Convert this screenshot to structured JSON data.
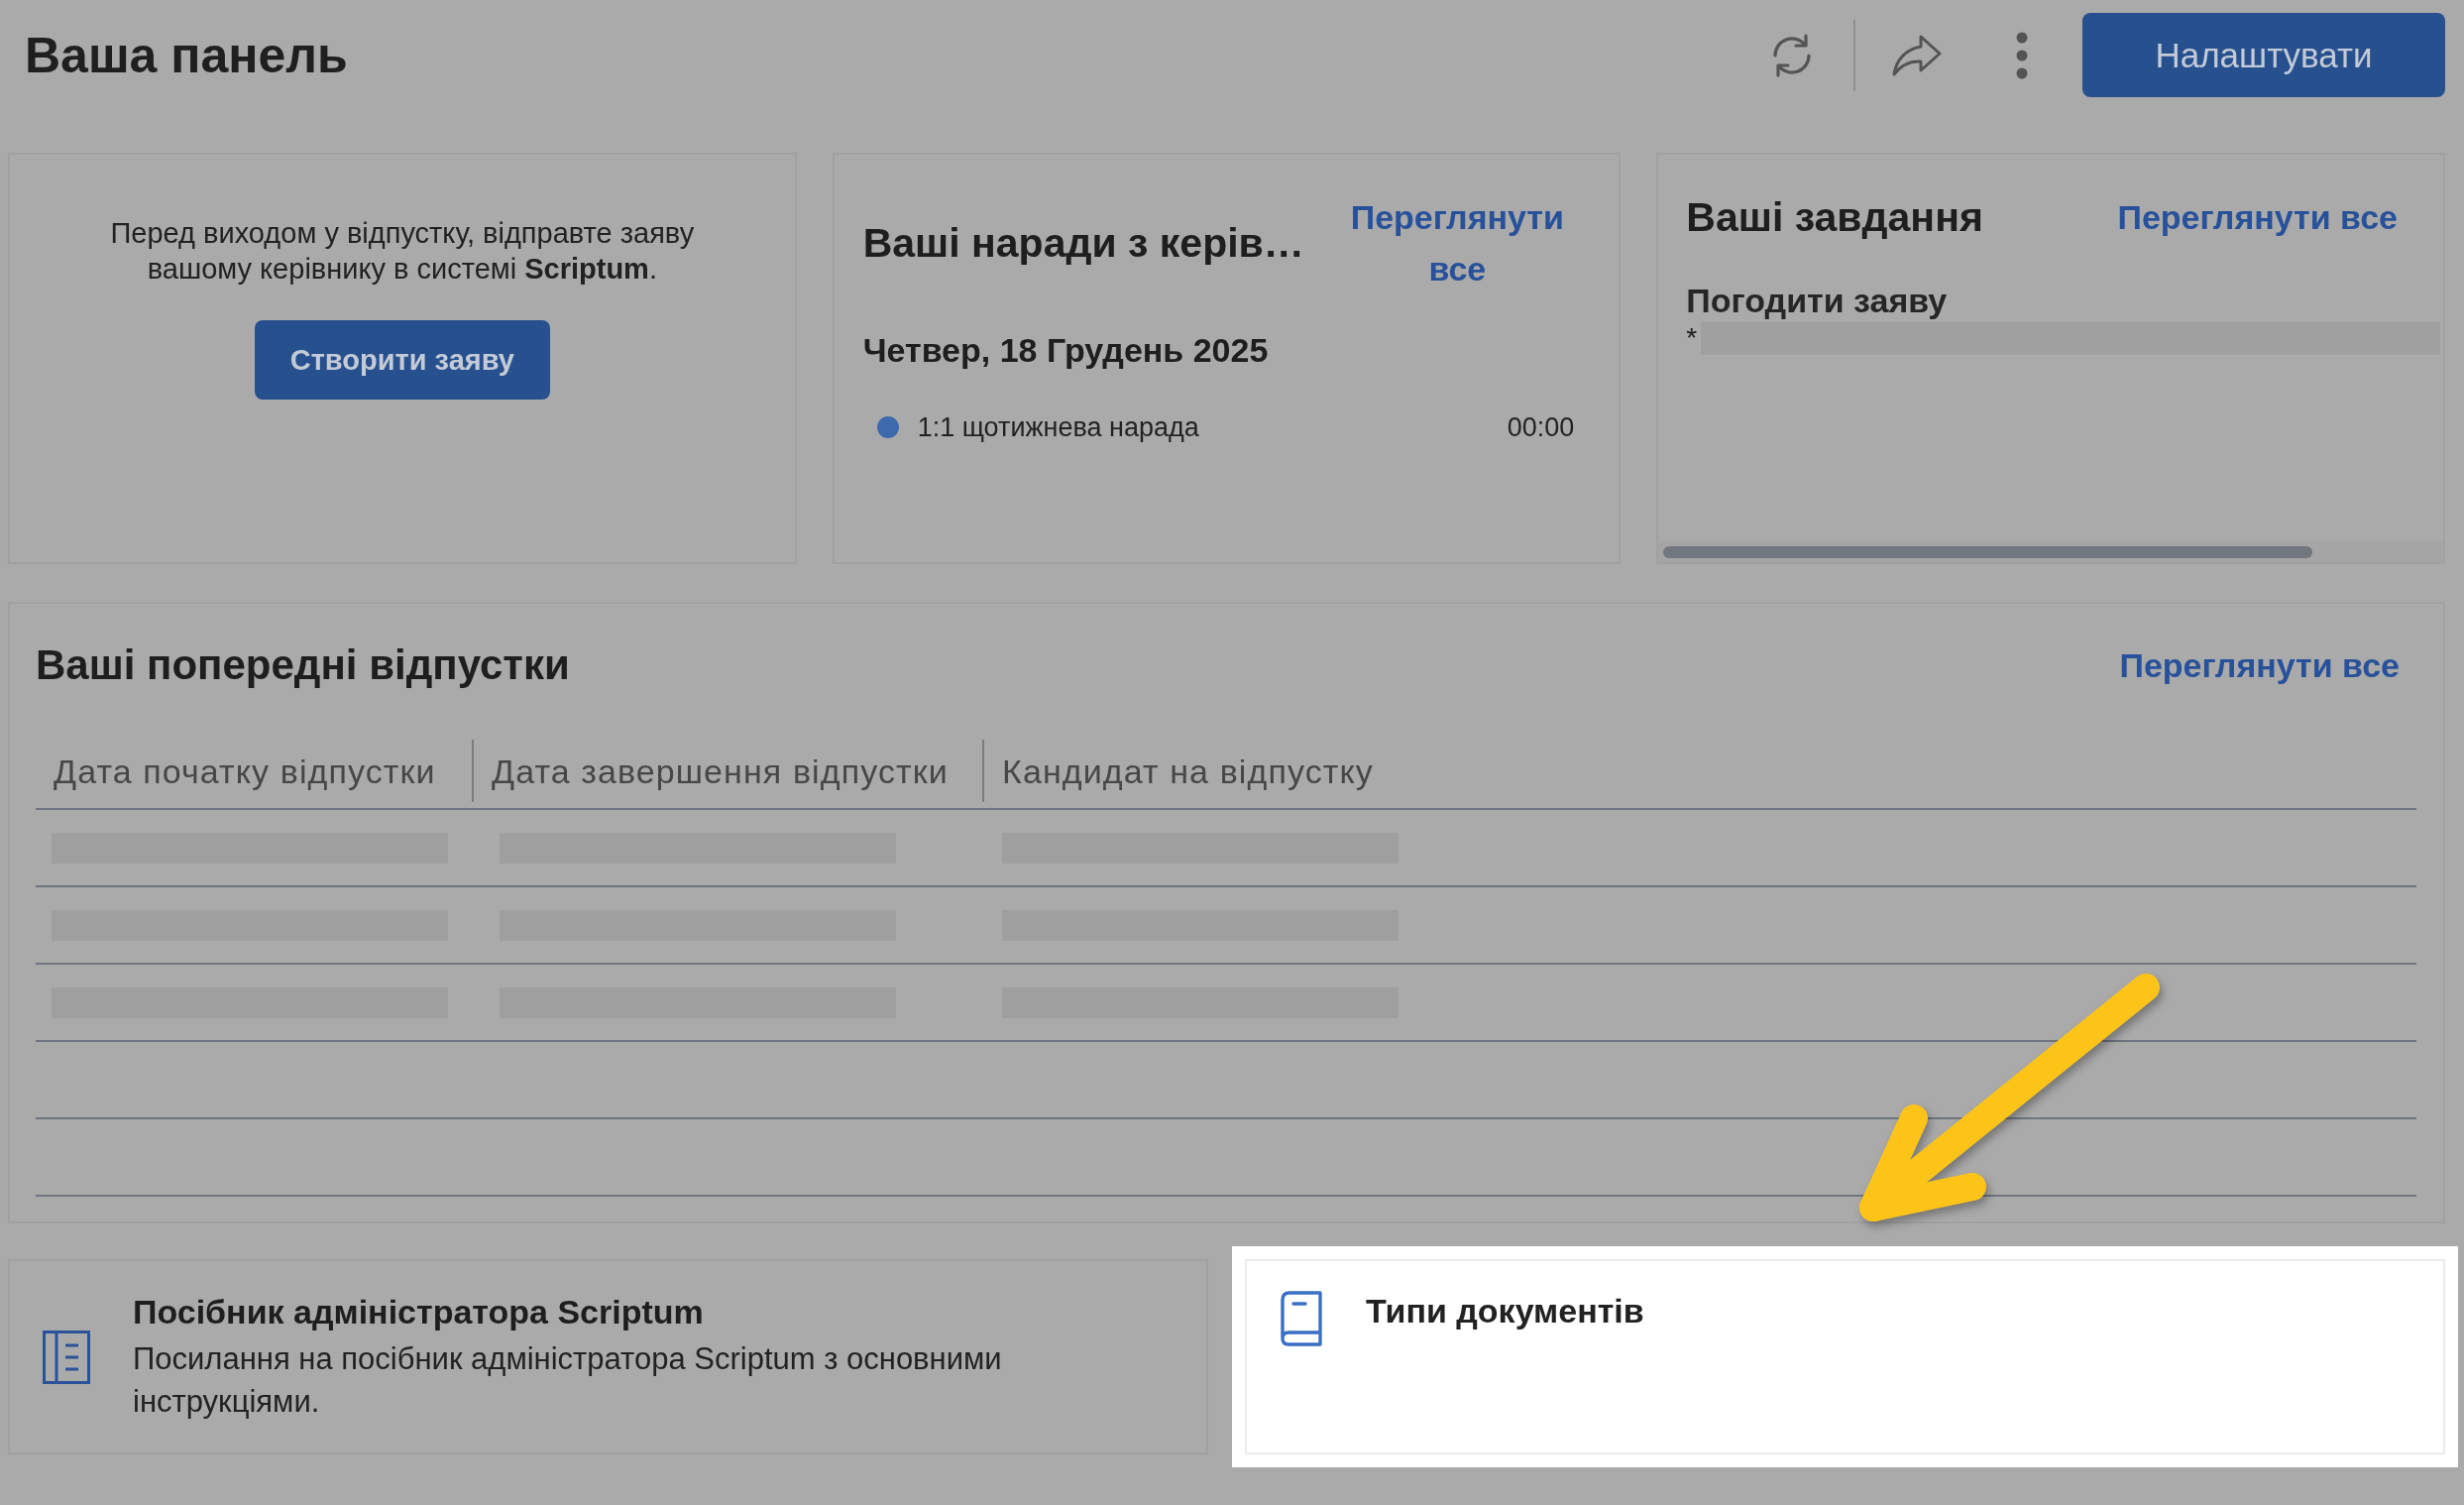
{
  "header": {
    "title": "Ваша панель",
    "settings_button": "Налаштувати"
  },
  "leave_request": {
    "message": "Перед виходом у відпустку, відправте заяву вашому керівнику в системі **Scriptum**.",
    "button": "Створити заяву"
  },
  "meetings": {
    "title": "Ваші наради з керів…",
    "view_all": "Переглянути все",
    "date": "Четвер, 18 Грудень 2025",
    "items": [
      {
        "title": "1:1 щотижнева нарада",
        "time": "00:00"
      }
    ]
  },
  "tasks": {
    "title": "Ваші завдання",
    "view_all": "Переглянути все",
    "items": [
      {
        "title": "Погодити заяву",
        "note": "*",
        "masked": true
      }
    ]
  },
  "previous_leaves": {
    "title": "Ваші попередні відпустки",
    "view_all": "Переглянути все",
    "columns": [
      "Дата початку відпустки",
      "Дата завершення відпустки",
      "Кандидат на відпустку"
    ],
    "rows": [
      {
        "loading": true
      },
      {
        "loading": true
      },
      {
        "loading": true
      },
      {
        "loading": false
      },
      {
        "loading": false
      }
    ]
  },
  "resources": [
    {
      "kind": "guide",
      "title": "Посібник адміністратора Scriptum",
      "description": "Посилання на посібник адміністратора Scriptum з основними інструкціями.",
      "highlighted": false
    },
    {
      "kind": "book",
      "title": "Типи документів",
      "highlighted": true
    }
  ]
}
